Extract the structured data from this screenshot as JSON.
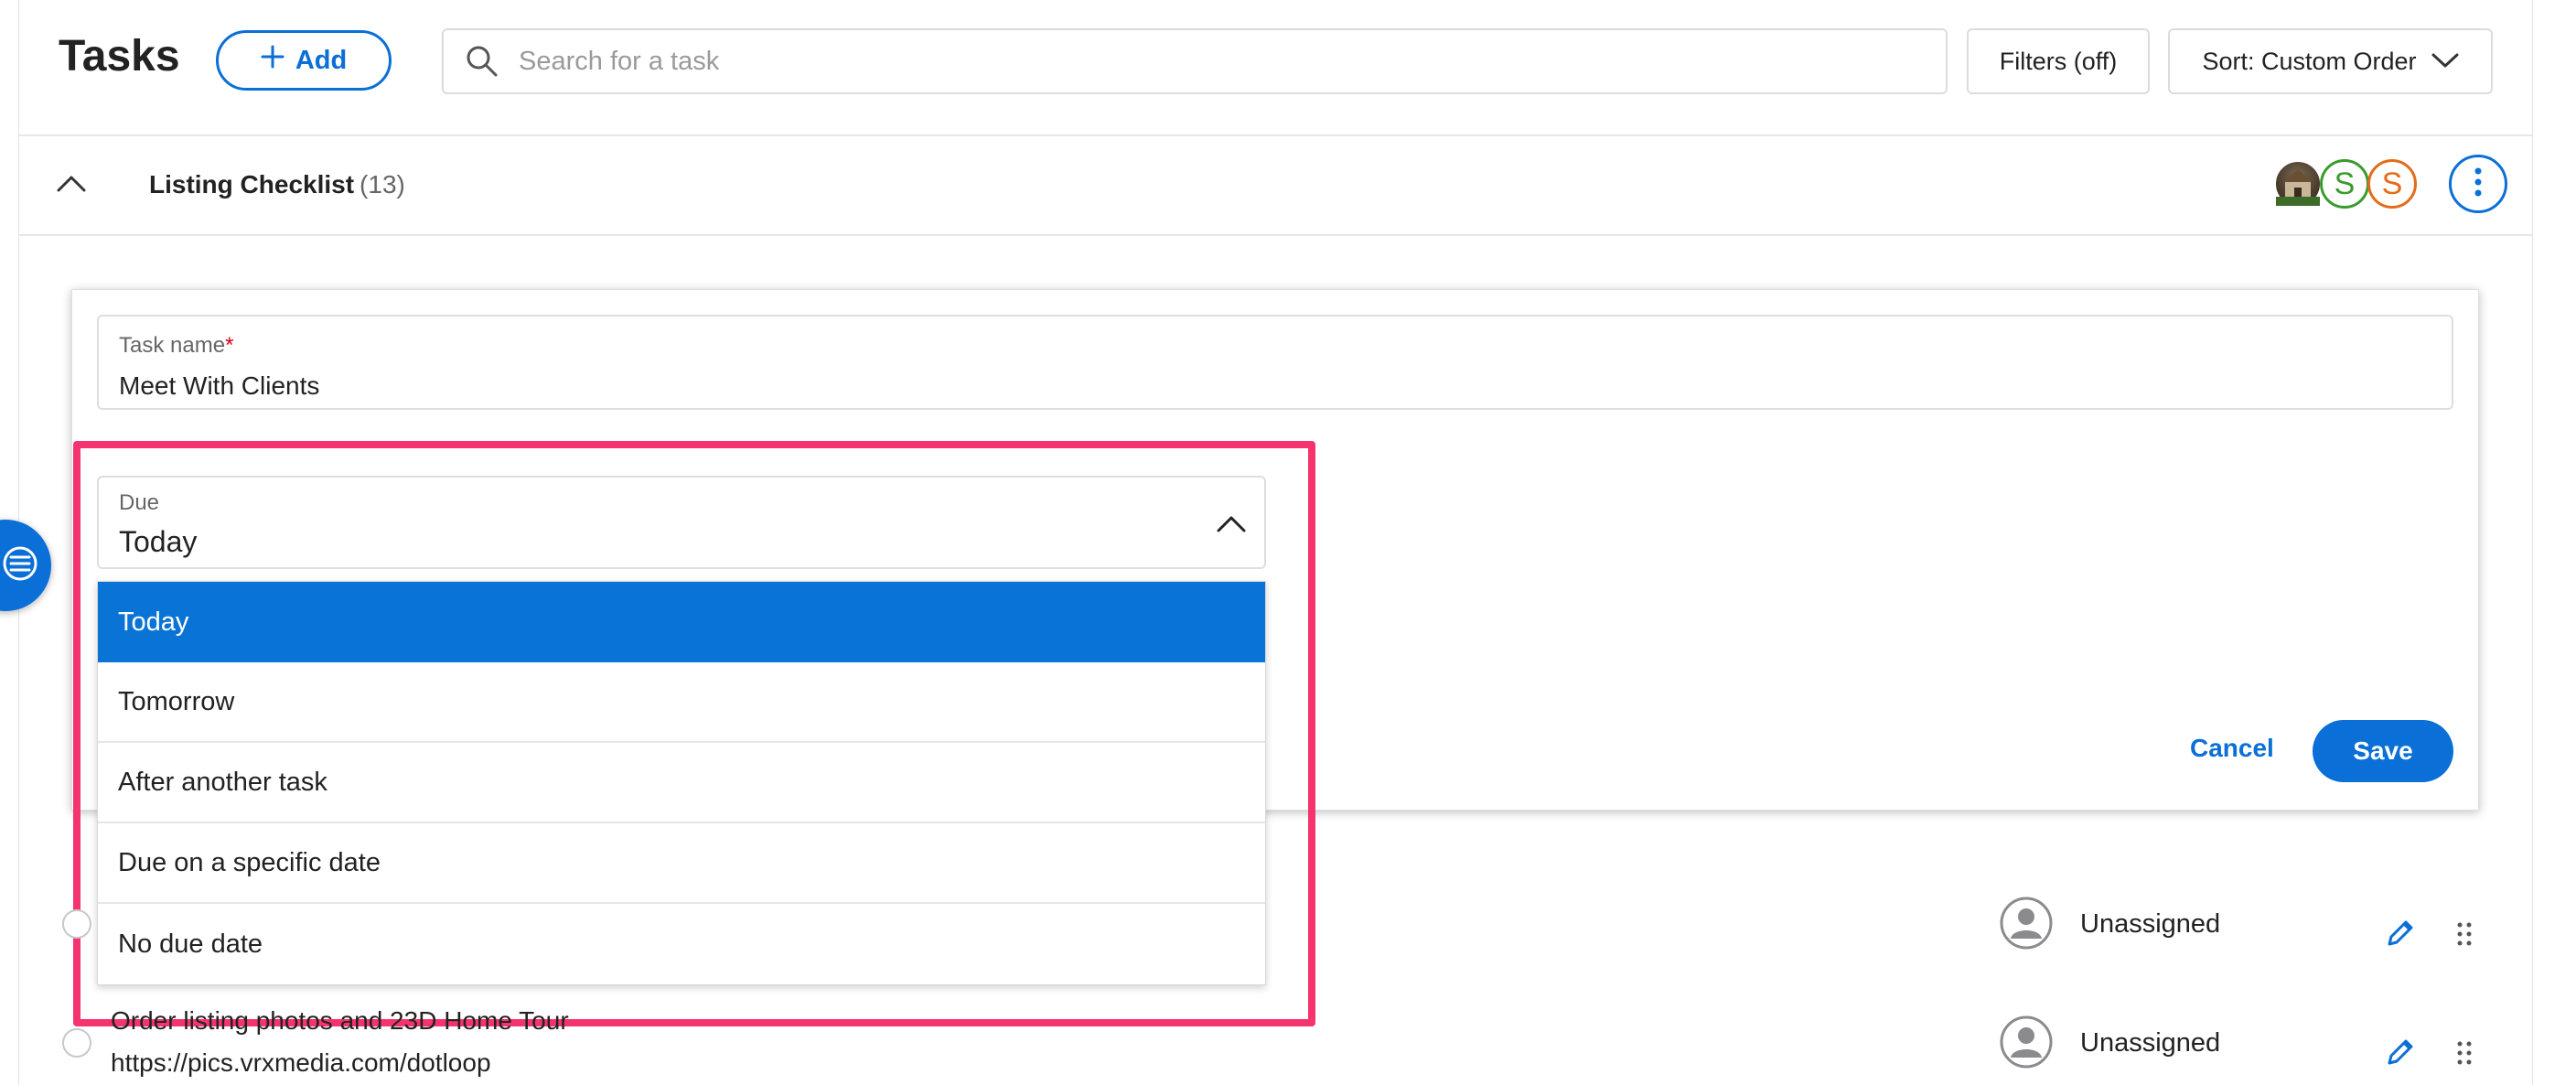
{
  "header": {
    "title": "Tasks",
    "add_label": "Add",
    "search_placeholder": "Search for a task",
    "filters_label": "Filters (off)",
    "sort_label": "Sort: Custom Order"
  },
  "checklist": {
    "title": "Listing Checklist",
    "count": "(13)",
    "avatars": [
      {
        "type": "photo",
        "name": "house-photo-avatar"
      },
      {
        "type": "initial",
        "initial": "S",
        "color": "#3a9b2e"
      },
      {
        "type": "initial",
        "initial": "S",
        "color": "#e26d1b"
      }
    ]
  },
  "edit_form": {
    "task_name_label": "Task name",
    "required_mark": "*",
    "task_name_value": "Meet With Clients",
    "due_label": "Due",
    "due_value": "Today",
    "due_options": [
      "Today",
      "Tomorrow",
      "After another task",
      "Due on a specific date",
      "No due date"
    ],
    "selected_option_index": 0,
    "cancel_label": "Cancel",
    "save_label": "Save"
  },
  "tasks": [
    {
      "text_line1": "",
      "text_line2": "",
      "assignee": "Unassigned"
    },
    {
      "text_line1": "Order listing photos and 23D Home Tour",
      "text_line2": "https://pics.vrxmedia.com/dotloop",
      "assignee": "Unassigned"
    }
  ],
  "colors": {
    "accent": "#0a6fd6",
    "selected_option": "#0a74d6",
    "highlight_box": "#f5336e"
  }
}
